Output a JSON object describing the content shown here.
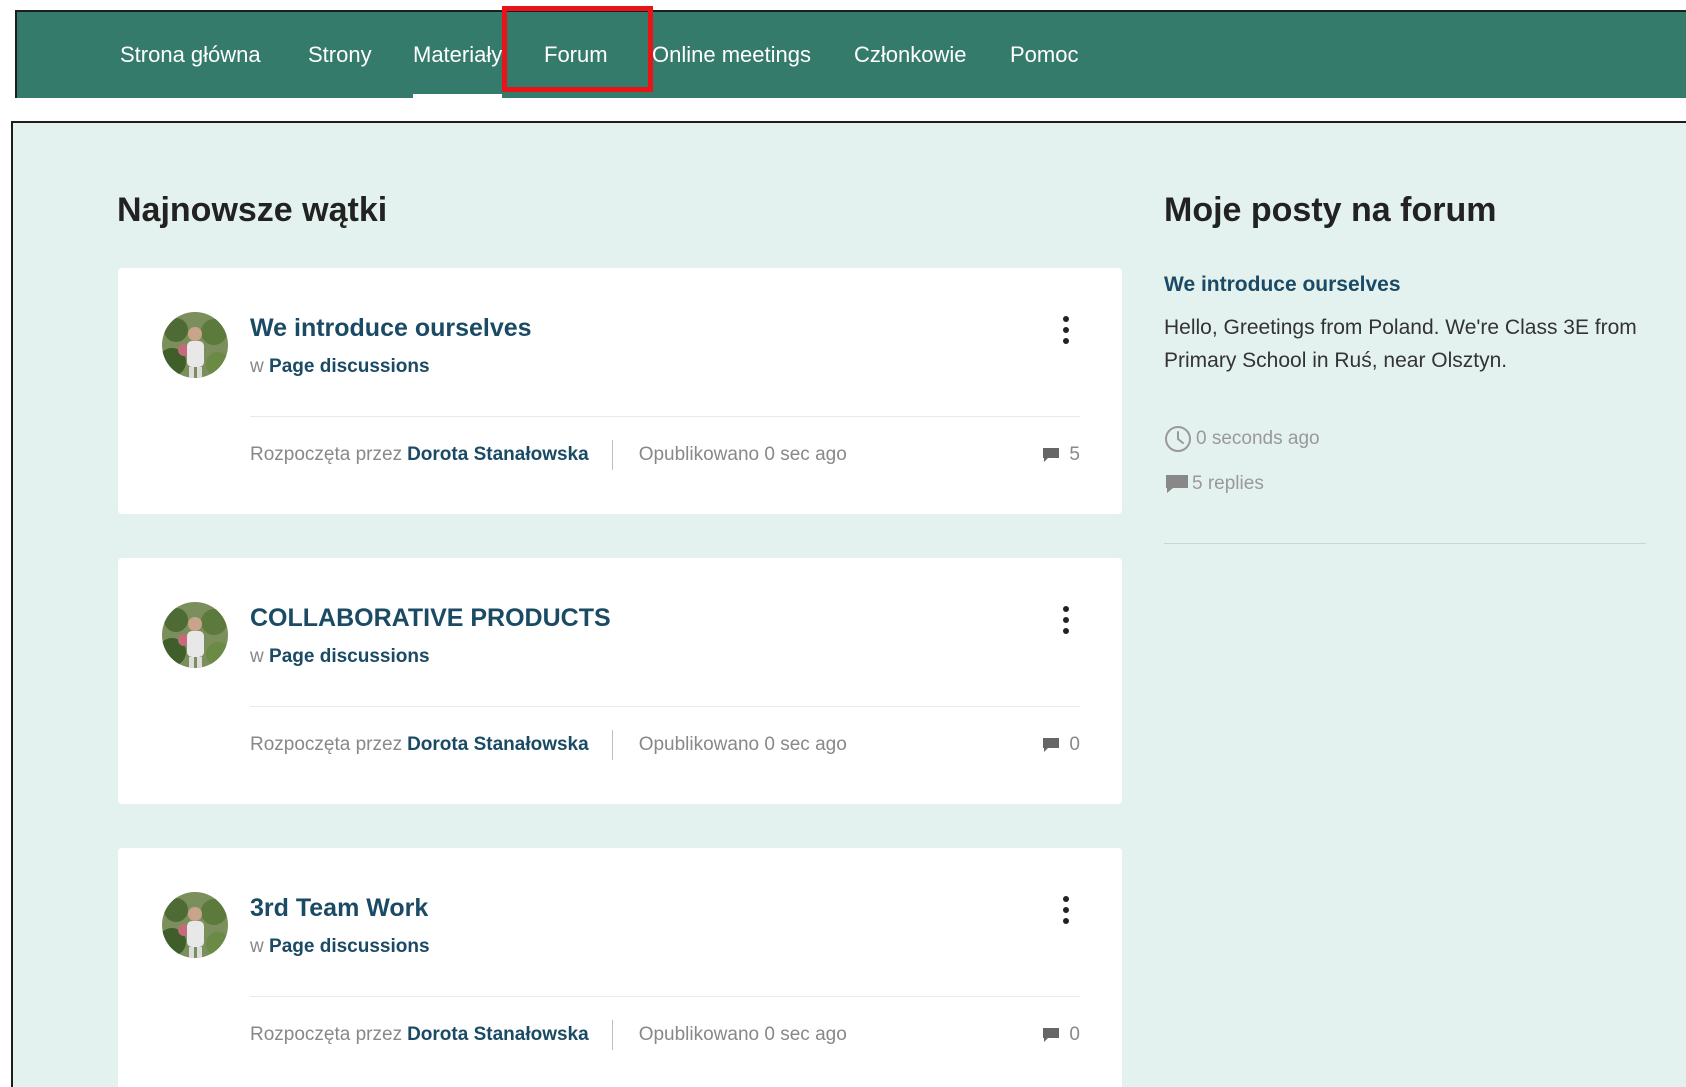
{
  "nav": {
    "items": [
      {
        "label": "Strona główna"
      },
      {
        "label": "Strony"
      },
      {
        "label": "Materiały"
      },
      {
        "label": "Forum"
      },
      {
        "label": "Online meetings"
      },
      {
        "label": "Członkowie"
      },
      {
        "label": "Pomoc"
      }
    ],
    "active": "Materiały",
    "highlighted": "Forum"
  },
  "latest": {
    "title": "Najnowsze wątki",
    "threads": [
      {
        "title": "We introduce ourselves",
        "in_prefix": "w",
        "category": "Page discussions",
        "started_by_label": "Rozpoczęta przez",
        "author": "Dorota Stanałowska",
        "published": "Opublikowano 0 sec ago",
        "replies": "5"
      },
      {
        "title": "COLLABORATIVE PRODUCTS",
        "in_prefix": "w",
        "category": "Page discussions",
        "started_by_label": "Rozpoczęta przez",
        "author": "Dorota Stanałowska",
        "published": "Opublikowano 0 sec ago",
        "replies": "0"
      },
      {
        "title": "3rd Team Work",
        "in_prefix": "w",
        "category": "Page discussions",
        "started_by_label": "Rozpoczęta przez",
        "author": "Dorota Stanałowska",
        "published": "Opublikowano 0 sec ago",
        "replies": "0"
      }
    ]
  },
  "my_posts": {
    "title": "Moje posty na forum",
    "post": {
      "title": "We introduce ourselves",
      "body": "Hello, Greetings from Poland. We're Class 3E from Primary School in Ruś, near Olsztyn.",
      "time": "0 seconds ago",
      "replies": "5 replies"
    }
  },
  "colors": {
    "nav_bg": "#357b6c",
    "page_bg": "#e4f2ef",
    "link": "#1a4a64",
    "highlight": "#e8141a"
  }
}
